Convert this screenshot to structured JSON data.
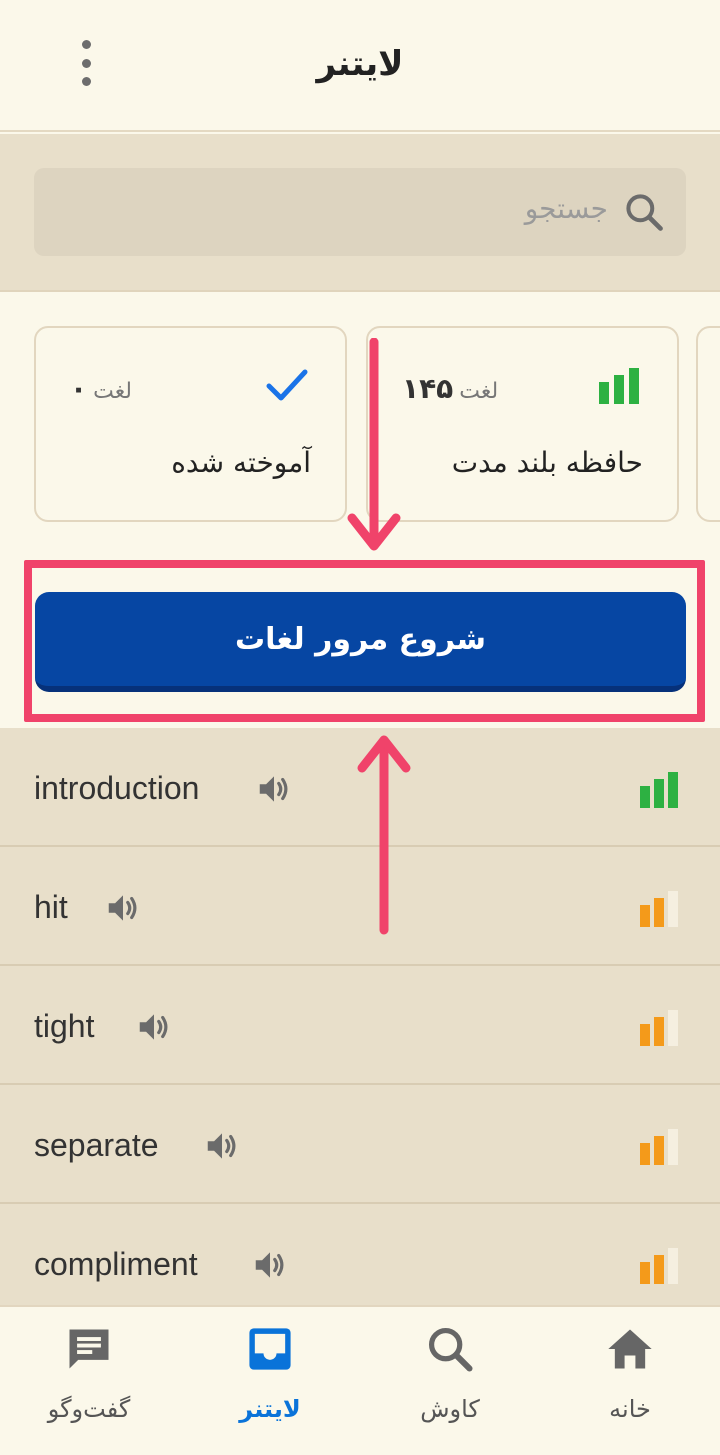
{
  "header": {
    "title": "لایتنر",
    "menu_icon": "more-vert-icon"
  },
  "search": {
    "placeholder": "جستجو",
    "icon": "search-icon"
  },
  "stats": {
    "learned": {
      "title": "آموخته شده",
      "count_label": "لغت",
      "count": "۰",
      "icon": "check-icon",
      "icon_color": "#1a73e8"
    },
    "long_term": {
      "title": "حافظه بلند مدت",
      "count_label": "لغت",
      "count": "۱۴۵",
      "icon": "signal-full-icon",
      "icon_color": "#2db142"
    }
  },
  "cta": {
    "label": "شروع مرور لغات",
    "color": "#0646a3"
  },
  "annotation": {
    "highlight_color": "#f0436a"
  },
  "words": [
    {
      "text": "introduction",
      "level": 3,
      "level_color": "#2db142"
    },
    {
      "text": "hit",
      "level": 2,
      "level_color": "#f49a1a"
    },
    {
      "text": "tight",
      "level": 2,
      "level_color": "#f49a1a"
    },
    {
      "text": "separate",
      "level": 2,
      "level_color": "#f49a1a"
    },
    {
      "text": "compliment",
      "level": 2,
      "level_color": "#f49a1a"
    }
  ],
  "nav": {
    "items": [
      {
        "label": "گفت‌وگو",
        "icon": "chat-icon",
        "active": false
      },
      {
        "label": "لایتنر",
        "icon": "inbox-icon",
        "active": true
      },
      {
        "label": "کاوش",
        "icon": "search-icon",
        "active": false
      },
      {
        "label": "خانه",
        "icon": "home-icon",
        "active": false
      }
    ]
  }
}
